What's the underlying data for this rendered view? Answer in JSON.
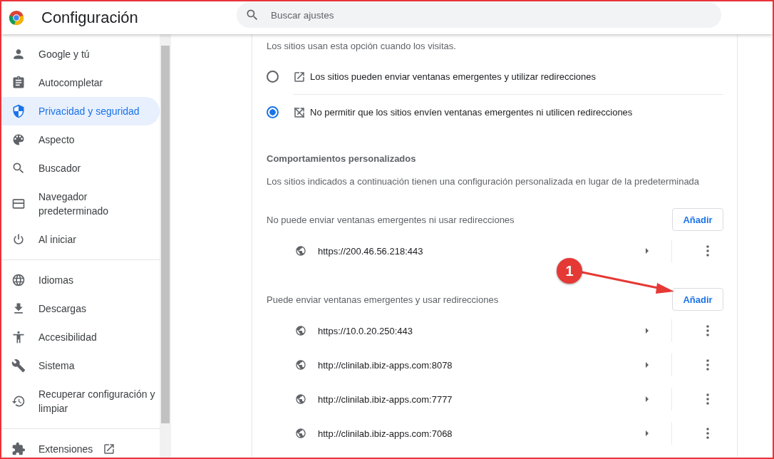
{
  "header": {
    "title": "Configuración",
    "search": {
      "placeholder": "Buscar ajustes"
    }
  },
  "sidebar": {
    "groups": [
      {
        "items": [
          {
            "label": "Google y tú",
            "selected": false
          },
          {
            "label": "Autocompletar",
            "selected": false
          },
          {
            "label": "Privacidad y seguridad",
            "selected": true
          },
          {
            "label": "Aspecto",
            "selected": false
          },
          {
            "label": "Buscador",
            "selected": false
          },
          {
            "label": "Navegador predeterminado",
            "selected": false
          },
          {
            "label": "Al iniciar",
            "selected": false
          }
        ]
      },
      {
        "items": [
          {
            "label": "Idiomas",
            "selected": false
          },
          {
            "label": "Descargas",
            "selected": false
          },
          {
            "label": "Accesibilidad",
            "selected": false
          },
          {
            "label": "Sistema",
            "selected": false
          },
          {
            "label": "Recuperar configuración y limpiar",
            "selected": false
          }
        ]
      },
      {
        "items": [
          {
            "label": "Extensiones",
            "selected": false,
            "external": true
          }
        ]
      }
    ]
  },
  "main": {
    "intro": "Los sitios usan esta opción cuando los visitas.",
    "options": [
      {
        "label": "Los sitios pueden enviar ventanas emergentes y utilizar redirecciones",
        "selected": false
      },
      {
        "label": "No permitir que los sitios envíen ventanas emergentes ni utilicen redirecciones",
        "selected": true
      }
    ],
    "custom": {
      "title": "Comportamientos personalizados",
      "description": "Los sitios indicados a continuación tienen una configuración personalizada en lugar de la predeterminada",
      "sections": [
        {
          "label": "No puede enviar ventanas emergentes ni usar redirecciones",
          "button": "Añadir",
          "sites": [
            "https://200.46.56.218:443"
          ]
        },
        {
          "label": "Puede enviar ventanas emergentes y usar redirecciones",
          "button": "Añadir",
          "sites": [
            "https://10.0.20.250:443",
            "http://clinilab.ibiz-apps.com:8078",
            "http://clinilab.ibiz-apps.com:7777",
            "http://clinilab.ibiz-apps.com:7068"
          ]
        }
      ]
    }
  },
  "annotation": {
    "number": "1"
  }
}
